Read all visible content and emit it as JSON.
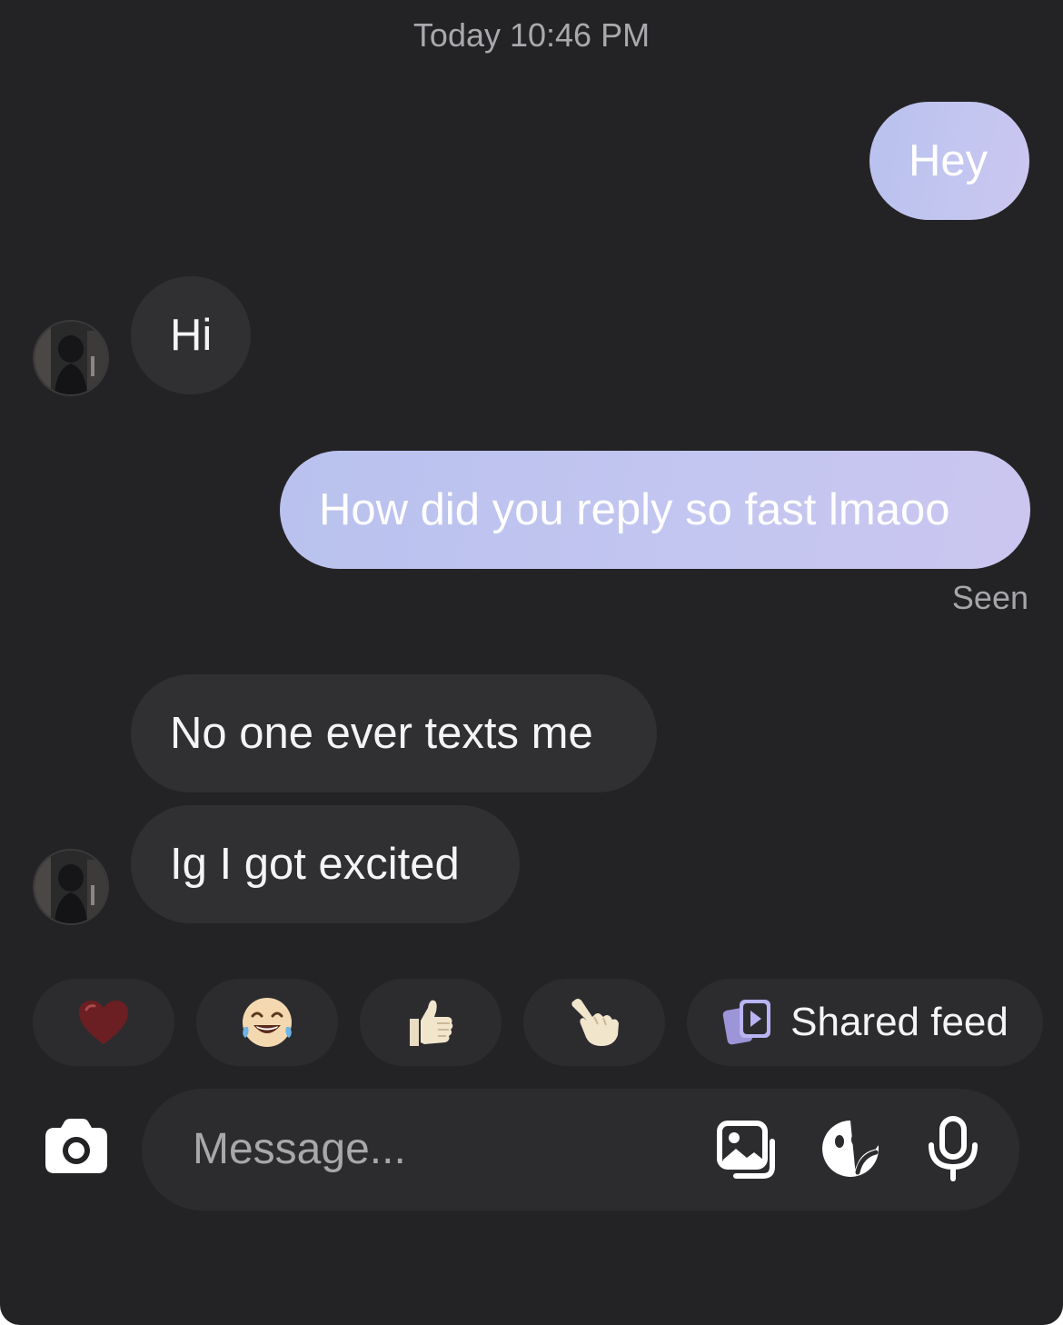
{
  "header": {
    "timestamp": "Today 10:46 PM"
  },
  "messages": [
    {
      "direction": "outgoing",
      "text": "Hey"
    },
    {
      "direction": "incoming",
      "text": "Hi"
    },
    {
      "direction": "outgoing",
      "text": "How did you reply so fast lmaoo"
    },
    {
      "direction": "incoming",
      "text": "No one ever texts me"
    },
    {
      "direction": "incoming",
      "text": "Ig I got excited"
    }
  ],
  "status": {
    "seen": "Seen"
  },
  "quick_replies": {
    "reactions": [
      "heart-emoji",
      "laughing-tears-emoji",
      "thumbs-up-emoji",
      "pointing-hand-emoji"
    ],
    "shared_feed_label": "Shared feed"
  },
  "composer": {
    "placeholder": "Message...",
    "icons": [
      "camera-icon",
      "gallery-icon",
      "sticker-icon",
      "microphone-icon"
    ]
  },
  "colors": {
    "background": "#232325",
    "outgoing_bubble": "#c0c4ef",
    "incoming_bubble": "#303033",
    "chip_background": "#2c2c2f",
    "accent_purple": "#b9b4f2"
  }
}
